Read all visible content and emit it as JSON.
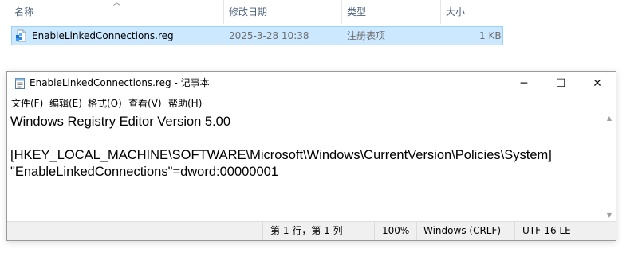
{
  "explorer": {
    "columns": {
      "name": "名称",
      "modified": "修改日期",
      "type": "类型",
      "size": "大小"
    },
    "file": {
      "name": "EnableLinkedConnections.reg",
      "modified": "2025-3-28 10:38",
      "type": "注册表项",
      "size": "1 KB",
      "icon": "registry-file-icon"
    }
  },
  "notepad": {
    "title": "EnableLinkedConnections.reg - 记事本",
    "controls": {
      "minimize": "─",
      "maximize": "☐",
      "close": "✕"
    },
    "menu": [
      "文件(F)",
      "编辑(E)",
      "格式(O)",
      "查看(V)",
      "帮助(H)"
    ],
    "content": "Windows Registry Editor Version 5.00\n\n[HKEY_LOCAL_MACHINE\\SOFTWARE\\Microsoft\\Windows\\CurrentVersion\\Policies\\System]\n\"EnableLinkedConnections\"=dword:00000001",
    "status": {
      "position": "第 1 行，第 1 列",
      "zoom": "100%",
      "line_ending": "Windows (CRLF)",
      "encoding": "UTF-16 LE"
    }
  },
  "colors": {
    "selection_fill": "#cce8ff",
    "selection_border": "#99d1ff",
    "header_text": "#4c607a",
    "statusbar_bg": "#f0f0f0"
  }
}
